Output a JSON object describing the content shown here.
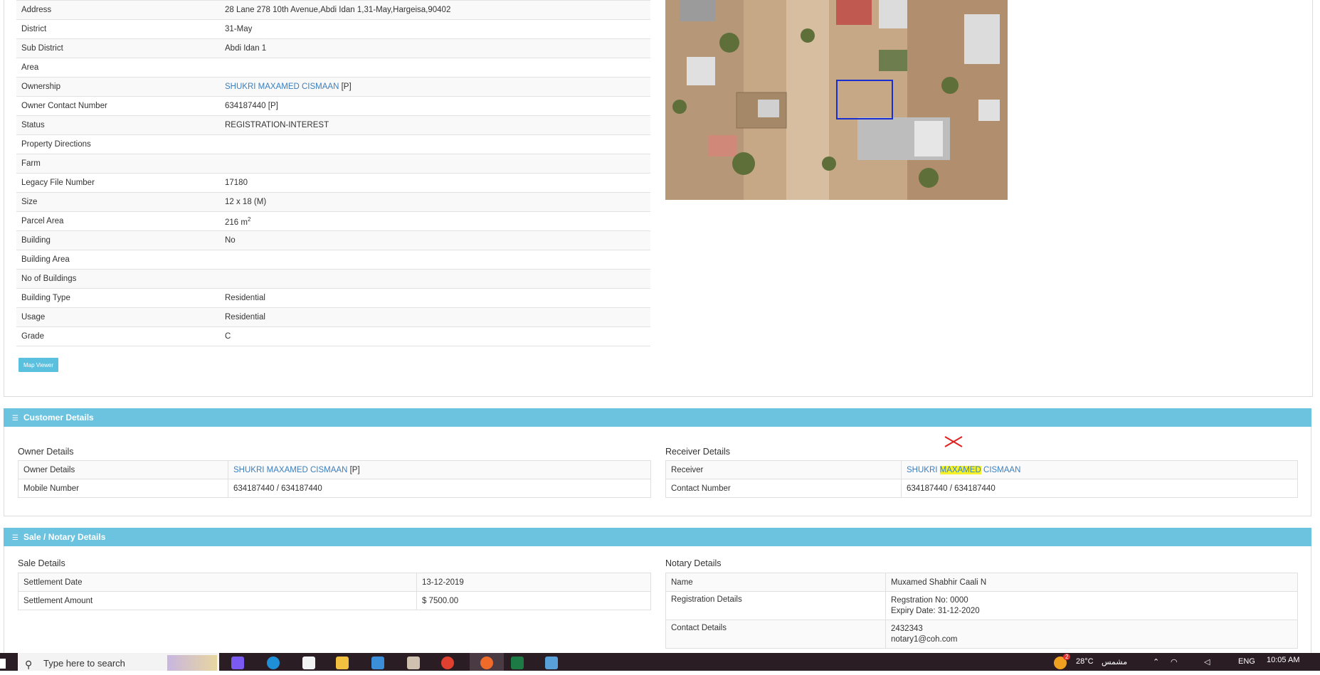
{
  "property": {
    "rows": [
      {
        "label": "Address",
        "value": "28 Lane 278 10th Avenue,Abdi Idan 1,31-May,Hargeisa,90402"
      },
      {
        "label": "District",
        "value": "31-May"
      },
      {
        "label": "Sub District",
        "value": "Abdi Idan 1"
      },
      {
        "label": "Area",
        "value": ""
      },
      {
        "label": "Ownership",
        "value": "SHUKRI MAXAMED CISMAAN",
        "suffix": " [P]"
      },
      {
        "label": "Owner Contact Number",
        "value": "634187440 [P]"
      },
      {
        "label": "Status",
        "value": "REGISTRATION-INTEREST"
      },
      {
        "label": "Property Directions",
        "value": ""
      },
      {
        "label": "Farm",
        "value": ""
      },
      {
        "label": "Legacy File Number",
        "value": "17180"
      },
      {
        "label": "Size",
        "value": "12 x 18 (M)"
      },
      {
        "label": "Parcel Area",
        "value": "216 m",
        "sup": "2"
      },
      {
        "label": "Building",
        "value": "No"
      },
      {
        "label": "Building Area",
        "value": ""
      },
      {
        "label": "No of Buildings",
        "value": ""
      },
      {
        "label": "Building Type",
        "value": "Residential"
      },
      {
        "label": "Usage",
        "value": "Residential"
      },
      {
        "label": "Grade",
        "value": "C"
      }
    ],
    "map_button": "Map Viewer"
  },
  "customer": {
    "title": "Customer Details",
    "owner_title": "Owner Details",
    "owner_rows": [
      {
        "label": "Owner Details",
        "value": "SHUKRI MAXAMED CISMAAN",
        "suffix": " [P]"
      },
      {
        "label": "Mobile Number",
        "value": "634187440 / 634187440"
      }
    ],
    "receiver_title": "Receiver Details",
    "receiver_rows": [
      {
        "label": "Receiver",
        "value_pre": "SHUKRI ",
        "value_hl": "MAXAMED",
        "value_post": " CISMAAN"
      },
      {
        "label": "Contact Number",
        "value": "634187440 / 634187440"
      }
    ]
  },
  "sale": {
    "title": "Sale / Notary Details",
    "sale_title": "Sale Details",
    "sale_rows": [
      {
        "label": "Settlement Date",
        "value": "13-12-2019"
      },
      {
        "label": "Settlement Amount",
        "value": "$ 7500.00"
      }
    ],
    "notary_title": "Notary Details",
    "notary_rows": [
      {
        "label": "Name",
        "value": "Muxamed Shabhir Caali N"
      },
      {
        "label": "Registration Details",
        "line1": "Regstration No: 0000",
        "line2": "Expiry Date: 31-12-2020"
      },
      {
        "label": "Contact Details",
        "line1": "2432343",
        "line2": "notary1@coh.com"
      }
    ]
  },
  "taskbar": {
    "search_placeholder": "Type here to search",
    "weather": "28°C",
    "weather_text": "مشمس",
    "lang": "ENG",
    "time": "10:05 AM",
    "badge": "2"
  },
  "colors": {
    "accent": "#6cc3e0",
    "link": "#3a7fc1",
    "button": "#5bc0de",
    "highlight": "#f6f22a",
    "plot_outline": "#1a2fd0",
    "annotation": "#e02020"
  },
  "icons": [
    "list-icon",
    "search-icon",
    "x-mark-icon",
    "windows-icon",
    "chevron-up-icon",
    "wifi-icon",
    "speaker-icon"
  ]
}
